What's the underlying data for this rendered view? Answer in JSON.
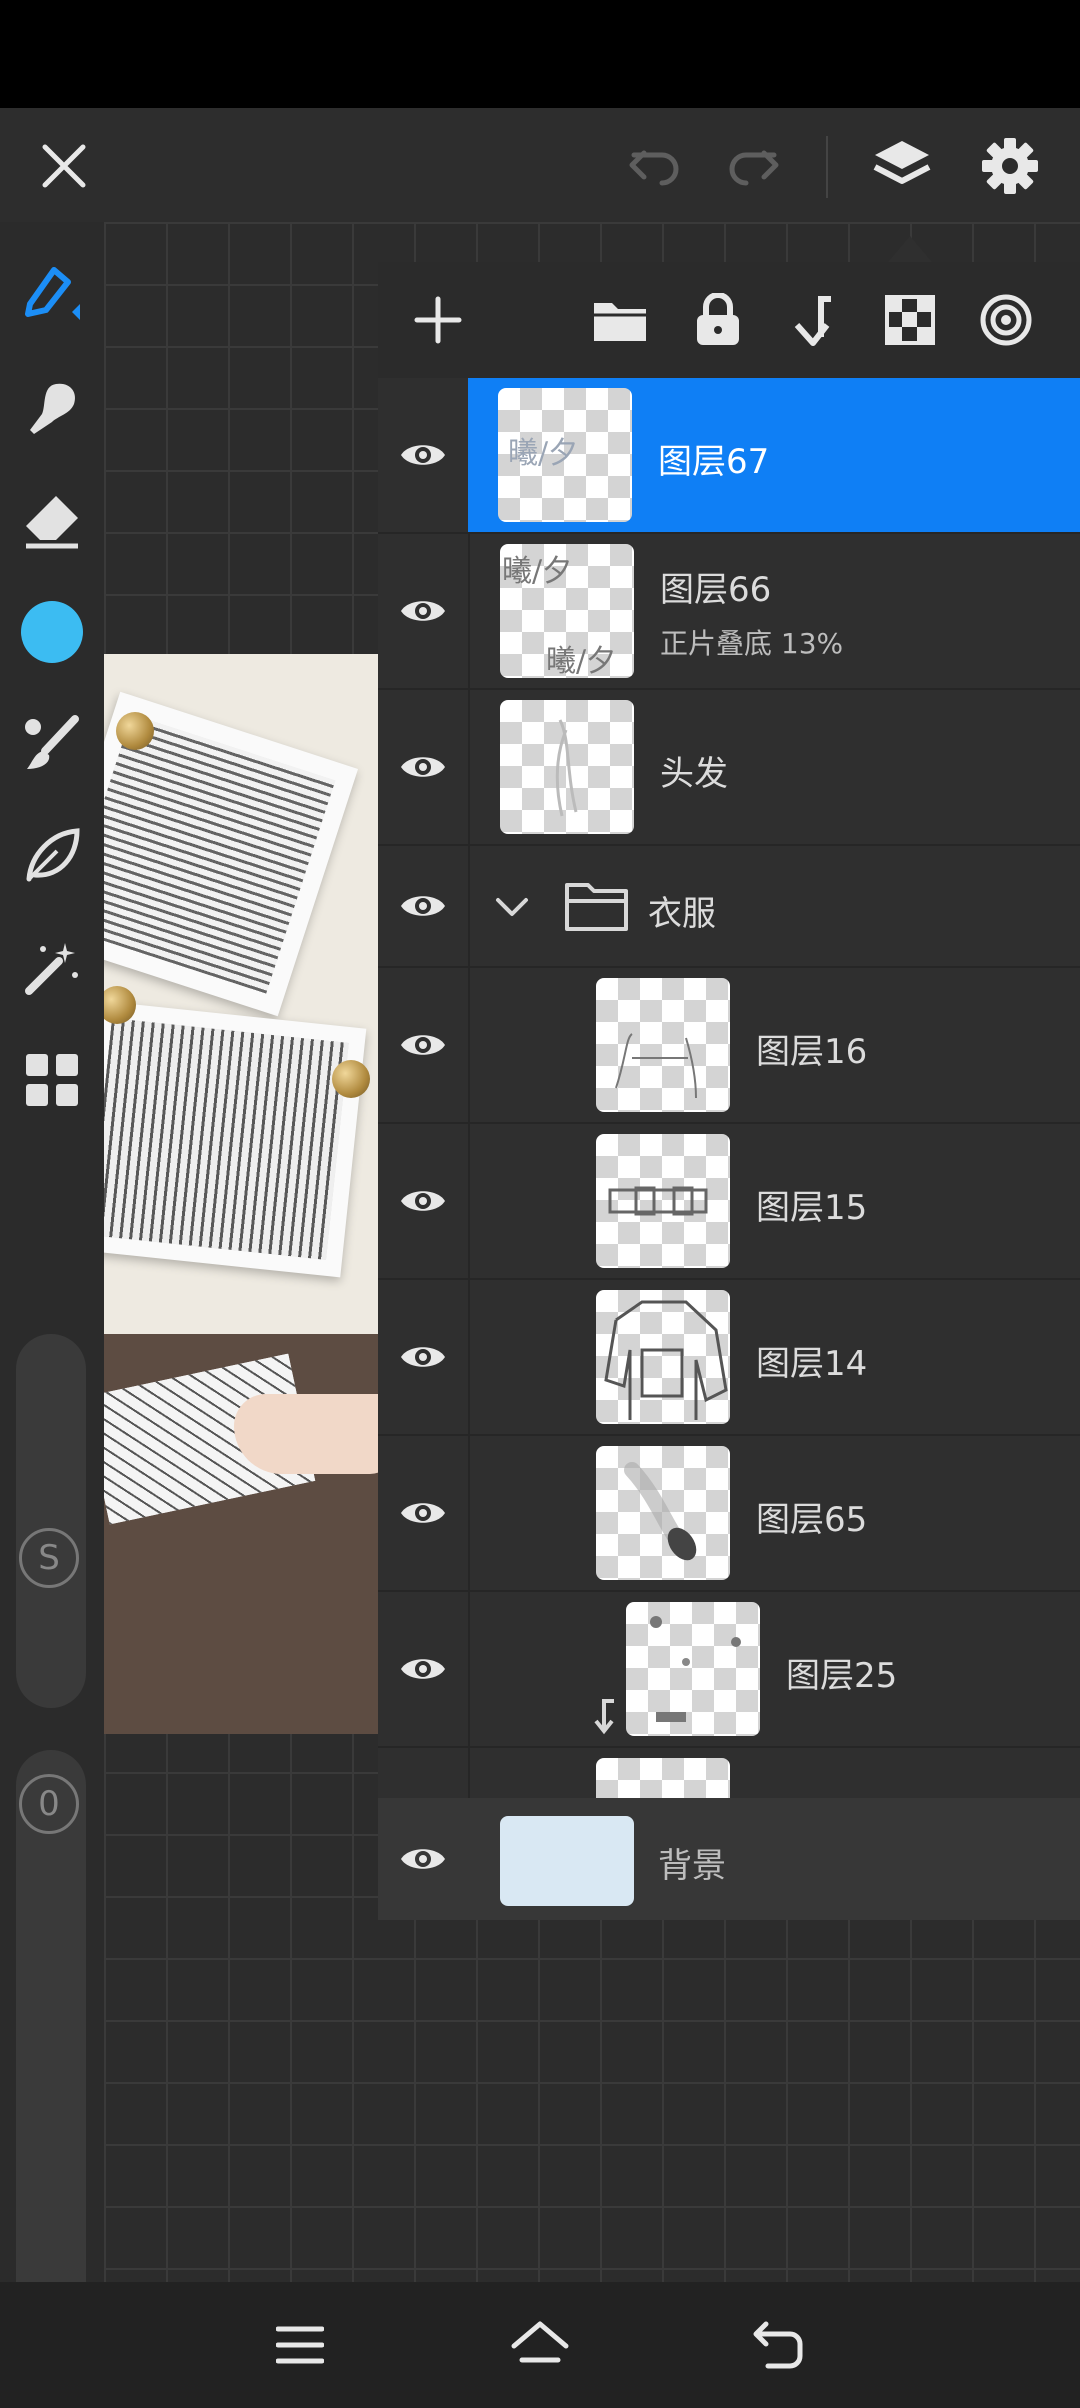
{
  "app": {
    "accent_color": "#0f7ff5",
    "current_color": "#3cbcf2",
    "top_bar": {
      "close_icon": "close-icon",
      "undo_icon": "undo-icon",
      "redo_icon": "redo-icon",
      "layers_icon": "layers-icon",
      "settings_icon": "gear-icon"
    },
    "left_toolbar": {
      "tools": [
        "pen-tool-icon",
        "smudge-tool-icon",
        "eraser-icon",
        "color-swatch",
        "brush-select-icon",
        "lasso-icon",
        "magic-wand-icon",
        "more-tools-grid-icon"
      ],
      "size_slider_label": "S",
      "opacity_slider_label": "0"
    },
    "layers_panel": {
      "toolbar_icons": [
        "add-layer-icon",
        "new-group-icon",
        "lock-icon",
        "merge-down-icon",
        "transparency-lock-icon",
        "blend-mode-icon"
      ],
      "layers": [
        {
          "name": "图层67",
          "selected": true,
          "thumb_text": "曦/夕"
        },
        {
          "name": "图层66",
          "sub": "正片叠底   13%",
          "thumb_text_top": "曦/夕",
          "thumb_text_bottom": "曦/夕"
        },
        {
          "name": "头发"
        },
        {
          "name": "衣服",
          "group": true,
          "expanded": true
        },
        {
          "name": "图层16"
        },
        {
          "name": "图层15"
        },
        {
          "name": "图层14"
        },
        {
          "name": "图层65"
        },
        {
          "name": "图层25",
          "clipped": true
        }
      ],
      "background_layer": {
        "name": "背景",
        "color": "#d9e8f3"
      }
    },
    "nav_bar": {
      "menu_icon": "menu-icon",
      "home_icon": "home-icon",
      "back_icon": "back-icon"
    }
  }
}
